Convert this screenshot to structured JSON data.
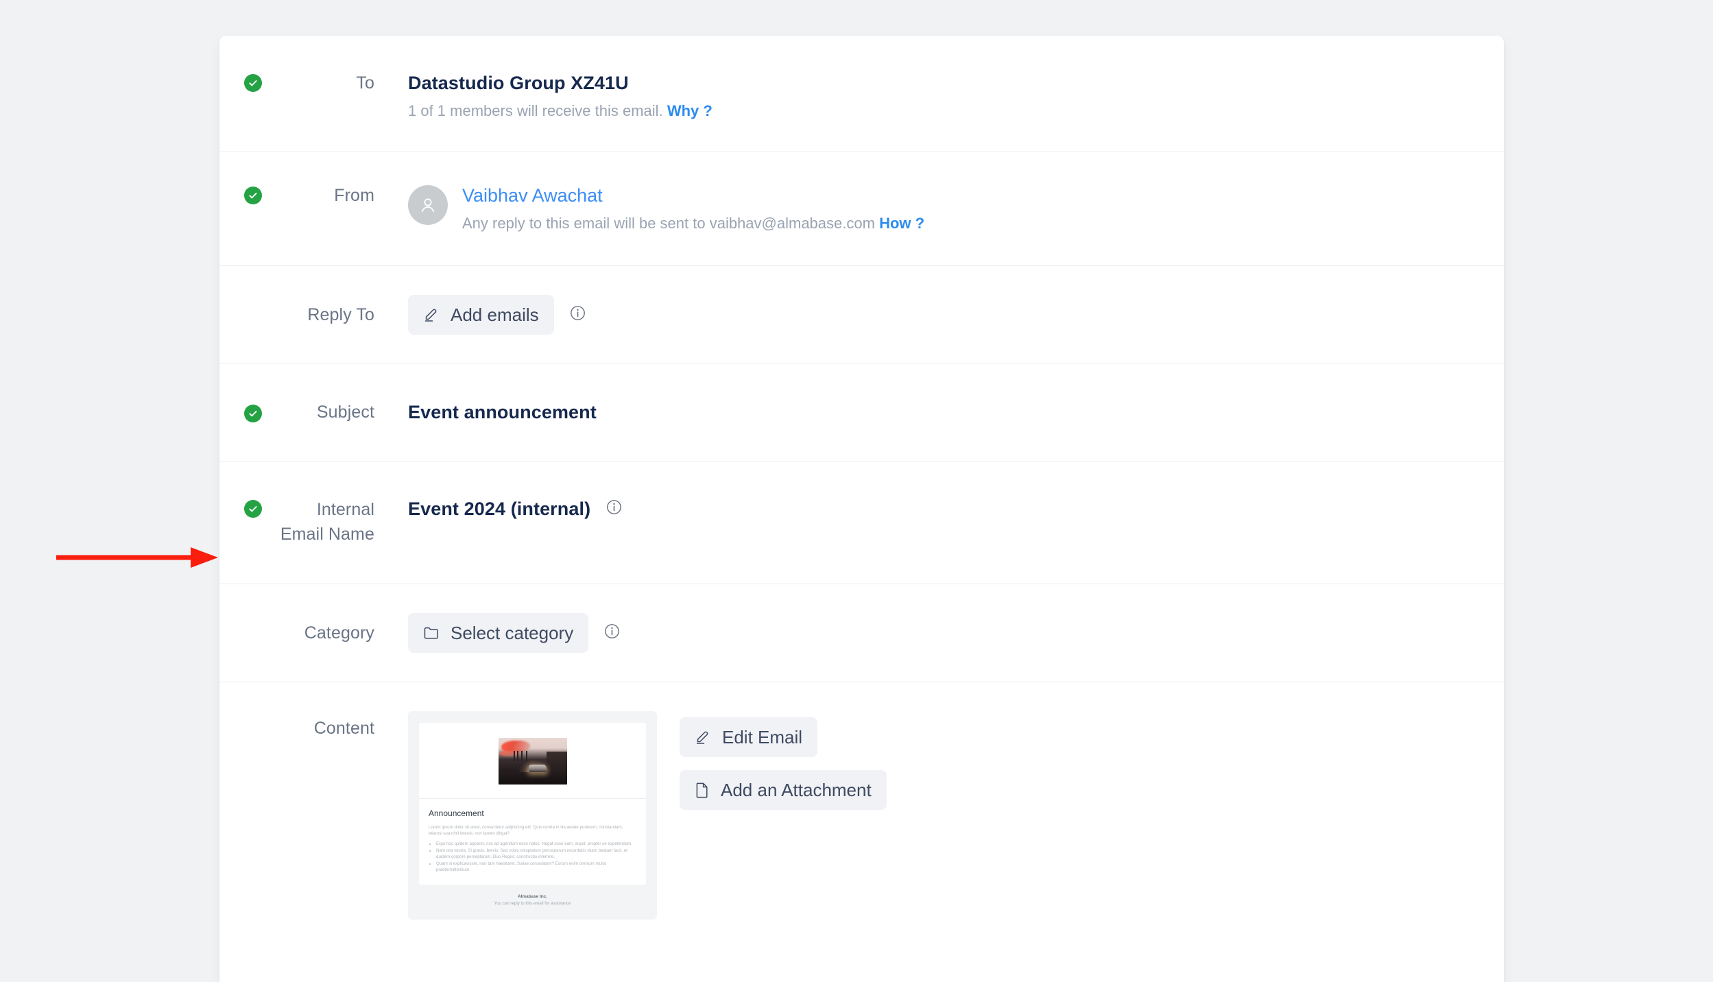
{
  "colors": {
    "page_background": "#f1f2f4",
    "card_background": "#ffffff",
    "check_green": "#25a244",
    "link_blue": "#2d8cf0",
    "title_navy": "#16284d",
    "label_gray": "#6a7486",
    "annotation_red": "#fa1e0e"
  },
  "annotation": {
    "type": "arrow",
    "direction": "right",
    "points_to": "internal-email-name-row",
    "color": "#fa1e0e"
  },
  "rows": {
    "to": {
      "label": "To",
      "status": "complete",
      "check_icon": "check-icon",
      "value": "Datastudio Group XZ41U",
      "subtext": "1 of 1 members will receive this email.",
      "link": "Why ?"
    },
    "from": {
      "label": "From",
      "status": "complete",
      "check_icon": "check-icon",
      "avatar_icon": "user-avatar-icon",
      "sender_name": "Vaibhav Awachat",
      "subtext": "Any reply to this email will be sent to vaibhav@almabase.com",
      "link": "How ?"
    },
    "reply_to": {
      "label": "Reply To",
      "button_label": "Add emails",
      "button_icon": "pencil-icon",
      "info_icon": "info-icon"
    },
    "subject": {
      "label": "Subject",
      "status": "complete",
      "check_icon": "check-icon",
      "value": "Event announcement"
    },
    "internal_email_name": {
      "label_line1": "Internal",
      "label_line2": "Email Name",
      "status": "complete",
      "check_icon": "check-icon",
      "value": "Event 2024 (internal)",
      "info_icon": "info-icon"
    },
    "category": {
      "label": "Category",
      "button_label": "Select category",
      "button_icon": "folder-icon",
      "info_icon": "info-icon"
    },
    "content": {
      "label": "Content",
      "edit_button_label": "Edit Email",
      "edit_button_icon": "pencil-icon",
      "attachment_button_label": "Add an Attachment",
      "attachment_button_icon": "file-icon",
      "preview": {
        "hero_image_alt": "street-at-dusk-photo",
        "heading": "Announcement",
        "paragraph": "Lorem ipsum dolor sit amet, consectetur adipiscing elit. Quis contra in illa aetate pudorem, constantiam, etiamsi sua nihil intersit, non tamen diligat?",
        "bullets": [
          "Ergo hoc quidem apparet, nos ad agendum esse natos. Negat esse eam, inquit, propter se expetendam.",
          "Nam ista vestra: Si gravis, brevis; Sed vobis voluptatum perceptarum recordatio vitam beatam facit, et quidem corpore perceptarum. Duo Reges: constructio interrete.",
          "Quam si explicavisset, non tam haesitaret. Suliae consulatum? Eorum enim omnium multa praetermittentium"
        ],
        "footer_company": "Almabase Inc.",
        "footer_note": "You can reply to this email for assistance"
      }
    }
  }
}
